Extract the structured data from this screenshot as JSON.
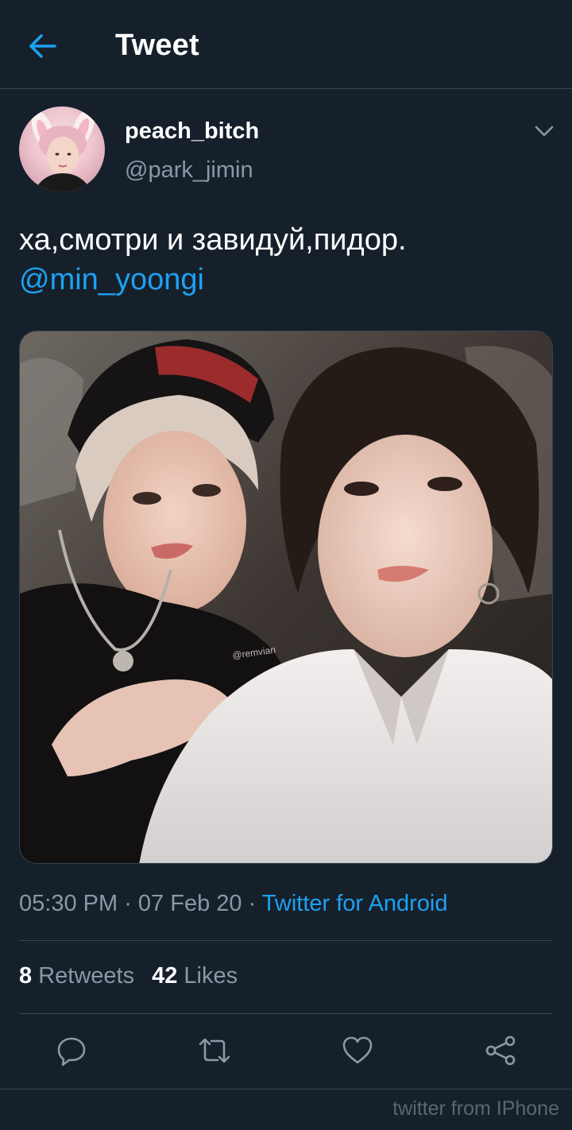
{
  "header": {
    "title": "Tweet",
    "back_icon": "arrow-left-icon"
  },
  "author": {
    "display_name": "peach_bitch",
    "handle": "@park_jimin",
    "menu_icon": "chevron-down-icon"
  },
  "tweet": {
    "text": "ха,смотри и завидуй,пидор.",
    "mention": "@min_yoongi",
    "media_watermark": "@remvian"
  },
  "meta": {
    "time": "05:30 PM",
    "separator": " · ",
    "date": "07 Feb 20",
    "source": "Twitter for Android"
  },
  "stats": {
    "retweets_count": "8",
    "retweets_label": "Retweets",
    "likes_count": "42",
    "likes_label": "Likes"
  },
  "actions": [
    "reply-icon",
    "retweet-icon",
    "like-icon",
    "share-icon"
  ],
  "footer_watermark": "twitter from IPhone",
  "colors": {
    "background": "#15202b",
    "accent": "#1da1f2",
    "secondary_text": "#8899a6",
    "divider": "#38444d"
  }
}
